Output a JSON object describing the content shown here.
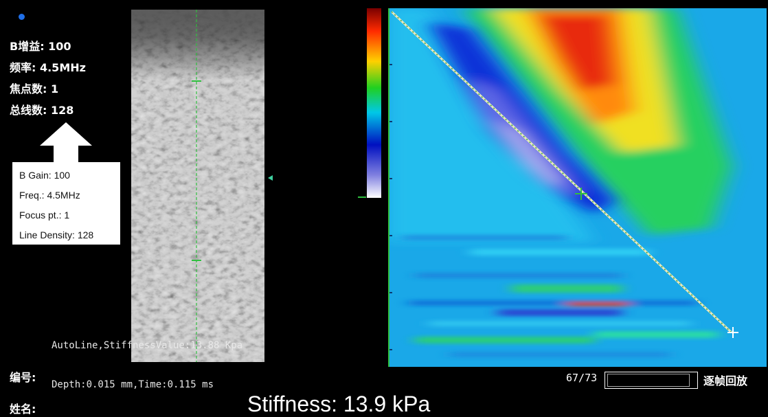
{
  "params_cn": [
    {
      "label": "B增益: 100"
    },
    {
      "label": "频率: 4.5MHz"
    },
    {
      "label": "焦点数: 1"
    },
    {
      "label": "总线数: 128"
    }
  ],
  "params_en": [
    {
      "label": "B Gain: 100"
    },
    {
      "label": "Freq.: 4.5MHz"
    },
    {
      "label": "Focus pt.: 1"
    },
    {
      "label": "Line Density: 128"
    }
  ],
  "overlay": {
    "line1": "AutoLine,StiffnessValue:13.88 Kpa",
    "line2": "Depth:0.015 mm,Time:0.115 ms"
  },
  "footer": {
    "id_label": "编号:",
    "name_label": "姓名:",
    "frame_counter": "67/73",
    "playback_label": "逐帧回放",
    "stiffness": "Stiffness: 13.9 kPa"
  },
  "colors": {
    "marker": "#1f6fe8",
    "guide": "#2fbf3f",
    "background": "#000000"
  }
}
